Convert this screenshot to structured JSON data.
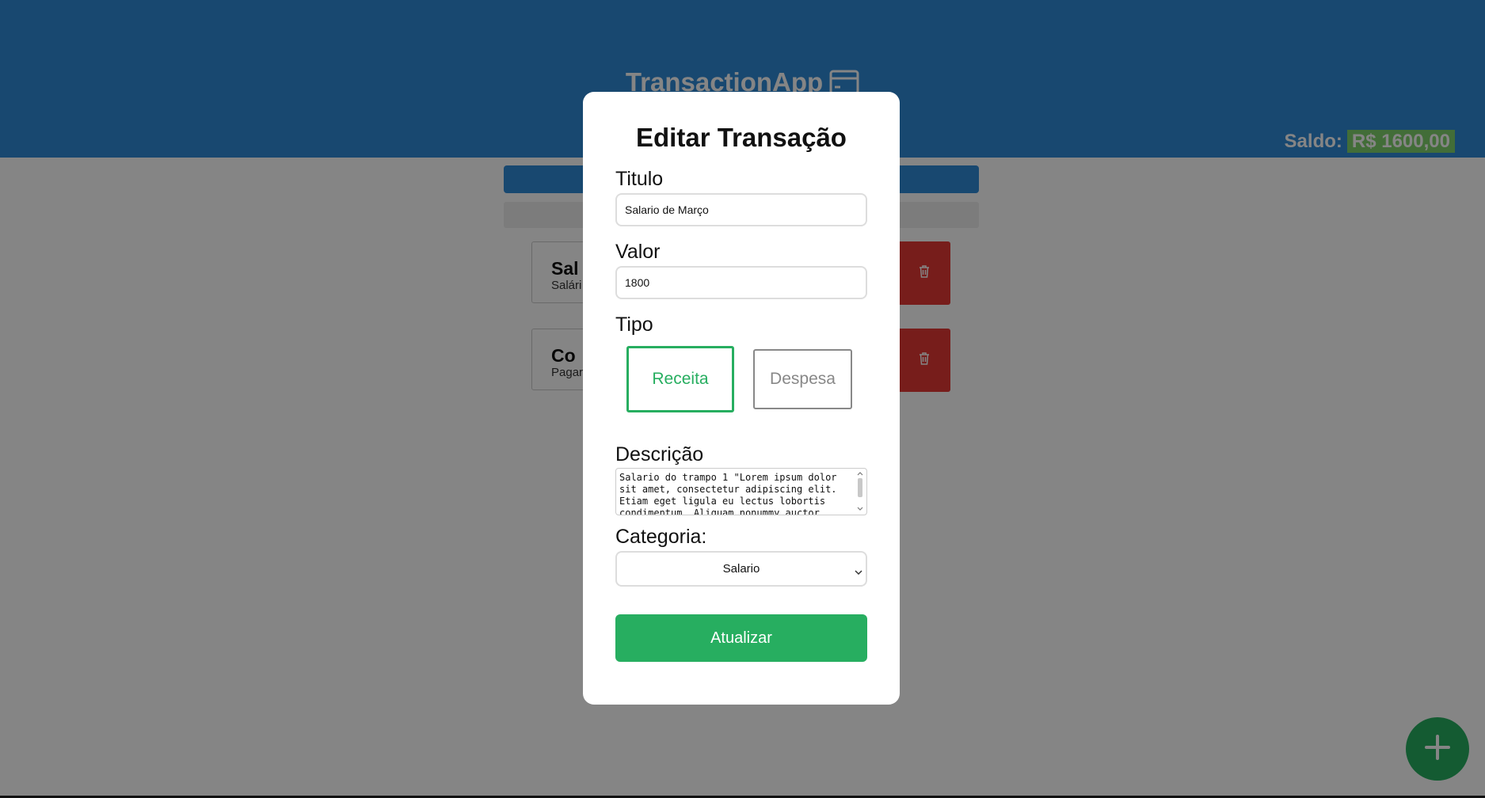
{
  "app": {
    "title": "TransactionApp"
  },
  "balance": {
    "label": "Saldo:",
    "amount": "R$ 1600,00"
  },
  "transactions": [
    {
      "title": "Sal",
      "description": "Salári"
    },
    {
      "title": "Co",
      "description": "Pagar"
    }
  ],
  "modal": {
    "title": "Editar Transação",
    "titulo_label": "Titulo",
    "titulo_value": "Salario de Março",
    "valor_label": "Valor",
    "valor_value": "1800",
    "tipo_label": "Tipo",
    "tipo_options": [
      "Receita",
      "Despesa"
    ],
    "tipo_selected": "Receita",
    "descricao_label": "Descrição",
    "descricao_value": "Salario do trampo 1 \"Lorem ipsum dolor sit amet, consectetur adipiscing elit. Etiam eget ligula eu lectus lobortis condimentum. Aliquam nonummy auctor",
    "categoria_label": "Categoria:",
    "categoria_value": "Salario",
    "submit_label": "Atualizar"
  },
  "fab": {
    "icon": "plus-icon"
  },
  "colors": {
    "header": "#2e8ad6",
    "accent_green": "#27ae60",
    "delete_red": "#e53935",
    "balance_badge": "#7fd26b"
  }
}
